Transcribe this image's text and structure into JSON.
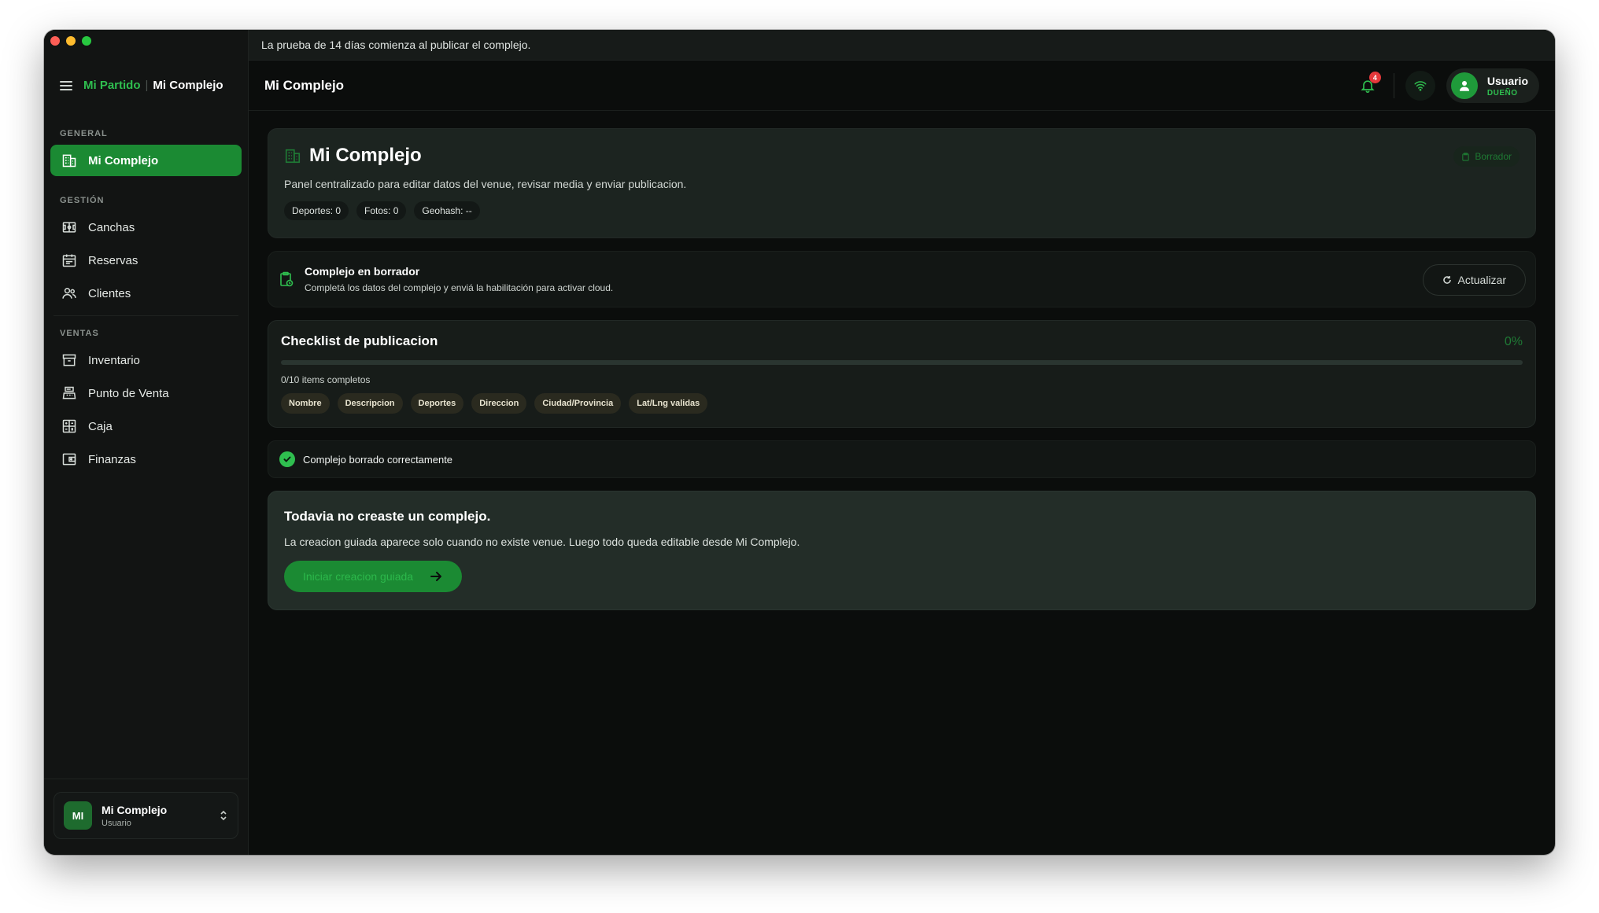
{
  "window": {
    "traffic_lights": [
      "close",
      "minimize",
      "zoom"
    ]
  },
  "sidebar": {
    "brand_app": "Mi Partido",
    "brand_separator": "|",
    "brand_venue": "Mi Complejo",
    "sections": [
      {
        "label": "GENERAL",
        "items": [
          {
            "label": "Mi Complejo",
            "icon": "building-icon",
            "active": true
          }
        ]
      },
      {
        "label": "GESTIÓN",
        "items": [
          {
            "label": "Canchas",
            "icon": "field-icon"
          },
          {
            "label": "Reservas",
            "icon": "calendar-icon"
          },
          {
            "label": "Clientes",
            "icon": "users-icon"
          }
        ]
      },
      {
        "label": "VENTAS",
        "items": [
          {
            "label": "Inventario",
            "icon": "archive-icon"
          },
          {
            "label": "Punto de Venta",
            "icon": "register-icon"
          },
          {
            "label": "Caja",
            "icon": "calculator-icon"
          },
          {
            "label": "Finanzas",
            "icon": "wallet-icon"
          }
        ]
      }
    ],
    "profile": {
      "initials": "MI",
      "name": "Mi Complejo",
      "role": "Usuario"
    }
  },
  "banner": {
    "text": "La prueba de 14 días comienza al publicar el complejo."
  },
  "topbar": {
    "title": "Mi Complejo",
    "notifications_count": "4",
    "user_name": "Usuario",
    "user_role": "DUEÑO"
  },
  "hero": {
    "title": "Mi Complejo",
    "subtitle": "Panel centralizado para editar datos del venue, revisar media y enviar publicacion.",
    "chips": [
      "Deportes: 0",
      "Fotos: 0",
      "Geohash: --"
    ],
    "badge": "Borrador"
  },
  "status": {
    "title": "Complejo en borrador",
    "description": "Completá los datos del complejo y enviá la habilitación para activar cloud.",
    "refresh_label": "Actualizar"
  },
  "checklist": {
    "title": "Checklist de publicacion",
    "percent_label": "0%",
    "progress": 0,
    "count_label": "0/10 items completos",
    "tags": [
      "Nombre",
      "Descripcion",
      "Deportes",
      "Direccion",
      "Ciudad/Provincia",
      "Lat/Lng validas"
    ]
  },
  "toast": {
    "message": "Complejo borrado correctamente"
  },
  "empty": {
    "title": "Todavia no creaste un complejo.",
    "description": "La creacion guiada aparece solo cuando no existe venue. Luego todo queda editable desde Mi Complejo.",
    "cta_label": "Iniciar creacion guiada"
  },
  "colors": {
    "accent": "#2fbe4f",
    "active_nav": "#1b8a33",
    "badge_red": "#e5383b"
  }
}
